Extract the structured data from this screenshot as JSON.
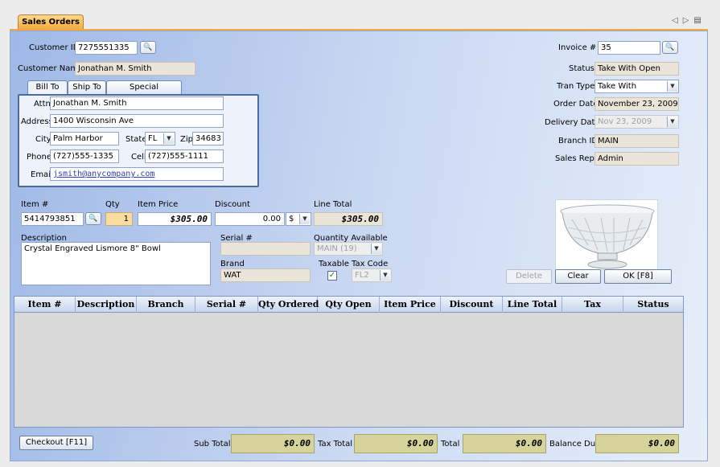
{
  "window": {
    "tab_title": "Sales Orders",
    "nav_prev": "◁",
    "nav_next": "▷",
    "nav_menu": "▤"
  },
  "customer": {
    "id_label": "Customer ID",
    "id_value": "7275551335",
    "name_label": "Customer Name",
    "name_value": "Jonathan M. Smith"
  },
  "subtabs": [
    "Bill To",
    "Ship To",
    "Special Instructions"
  ],
  "bill_to": {
    "attn_label": "Attn",
    "attn_value": "Jonathan  M. Smith",
    "address_label": "Address",
    "address_value": "1400 Wisconsin Ave",
    "city_label": "City",
    "city_value": "Palm Harbor",
    "state_label": "State",
    "state_value": "FL",
    "zip_label": "Zip",
    "zip_value": "34683",
    "phone_label": "Phone",
    "phone_value": "(727)555-1335",
    "cell_label": "Cell",
    "cell_value": "(727)555-1111",
    "email_label": "Email",
    "email_value": "jsmith@anycompany.com"
  },
  "invoice": {
    "invoice_label": "Invoice #",
    "invoice_value": "35",
    "status_label": "Status",
    "status_value": "Take With Open",
    "tran_type_label": "Tran Type",
    "tran_type_value": "Take With",
    "order_date_label": "Order Date",
    "order_date_value": "November 23, 2009",
    "delivery_date_label": "Delivery Date",
    "delivery_date_value": "Nov 23, 2009",
    "branch_label": "Branch ID",
    "branch_value": "MAIN",
    "rep_label": "Sales Rep.",
    "rep_value": "Admin"
  },
  "item": {
    "item_label": "Item #",
    "item_value": "5414793851",
    "qty_label": "Qty",
    "qty_value": "1",
    "price_label": "Item Price",
    "price_value": "$305.00",
    "discount_label": "Discount",
    "discount_value": "0.00",
    "discount_unit": "$",
    "line_total_label": "Line Total",
    "line_total_value": "$305.00",
    "description_label": "Description",
    "description_value": "Crystal Engraved Lismore 8\" Bowl",
    "serial_label": "Serial #",
    "serial_value": "",
    "qty_avail_label": "Quantity Available",
    "qty_avail_value": "MAIN (19)",
    "brand_label": "Brand",
    "brand_value": "WAT",
    "taxable_label": "Taxable",
    "taxable_checked": true,
    "tax_code_label": "Tax Code",
    "tax_code_value": "FL2"
  },
  "buttons": {
    "delete": "Delete",
    "clear": "Clear",
    "ok": "OK [F8]",
    "checkout": "Checkout [F11]"
  },
  "grid": {
    "columns": [
      "Item #",
      "Description",
      "Branch",
      "Serial #",
      "Qty Ordered",
      "Qty Open",
      "Item Price",
      "Discount",
      "Line Total",
      "Tax",
      "Status"
    ],
    "rows": []
  },
  "totals": {
    "subtotal_label": "Sub Total",
    "subtotal_value": "$0.00",
    "tax_label": "Tax Total",
    "tax_value": "$0.00",
    "total_label": "Total",
    "total_value": "$0.00",
    "balance_label": "Balance Due",
    "balance_value": "$0.00"
  },
  "colors": {
    "accent_tab": "#f4a93a",
    "panel": "#c9d8f2",
    "total_field": "#d6d49a"
  },
  "icons": {
    "lookup": "magnifier-icon",
    "dropdown": "chevron-down-icon",
    "check": "checkmark-icon"
  }
}
